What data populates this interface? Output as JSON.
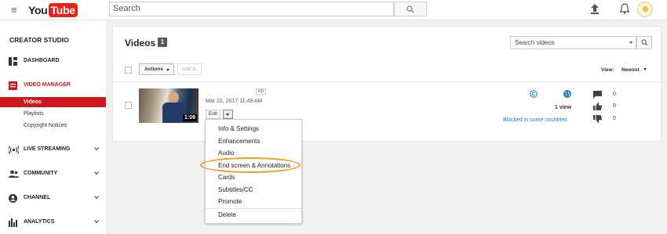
{
  "header": {
    "logo_you": "You",
    "logo_tube": "Tube",
    "search_placeholder": "Search"
  },
  "sidebar": {
    "title": "CREATOR STUDIO",
    "items": [
      {
        "label": "DASHBOARD",
        "icon": "dashboard-icon"
      },
      {
        "label": "VIDEO MANAGER",
        "icon": "video-manager-icon",
        "active": true
      },
      {
        "label": "LIVE STREAMING",
        "icon": "live-streaming-icon"
      },
      {
        "label": "COMMUNITY",
        "icon": "community-icon"
      },
      {
        "label": "CHANNEL",
        "icon": "channel-icon"
      },
      {
        "label": "ANALYTICS",
        "icon": "analytics-icon"
      }
    ],
    "subitems": [
      {
        "label": "Videos",
        "active": true
      },
      {
        "label": "Playlists"
      },
      {
        "label": "Copyright Notices"
      }
    ]
  },
  "videos": {
    "title": "Videos",
    "count": "1",
    "search_placeholder": "Search videos",
    "actions_label": "Actions",
    "add_to_label": "Add to",
    "view_label": "View:",
    "view_value": "Newest"
  },
  "video": {
    "duration": "1:09",
    "quality_badge": "HD",
    "date": "Mar 22, 2017 11:49 AM",
    "edit_label": "Edit",
    "views": "1 view",
    "restriction": "Blocked in some countries",
    "comments": "0",
    "likes": "0",
    "dislikes": "0"
  },
  "edit_menu": {
    "items": [
      "Info & Settings",
      "Enhancements",
      "Audio",
      "End screen & Annotations",
      "Cards",
      "Subtitles/CC",
      "Promote"
    ],
    "delete_label": "Delete",
    "highlight_color": "#f39c1e"
  },
  "colors": {
    "accent": "#cc181e",
    "link": "#167ac6"
  }
}
